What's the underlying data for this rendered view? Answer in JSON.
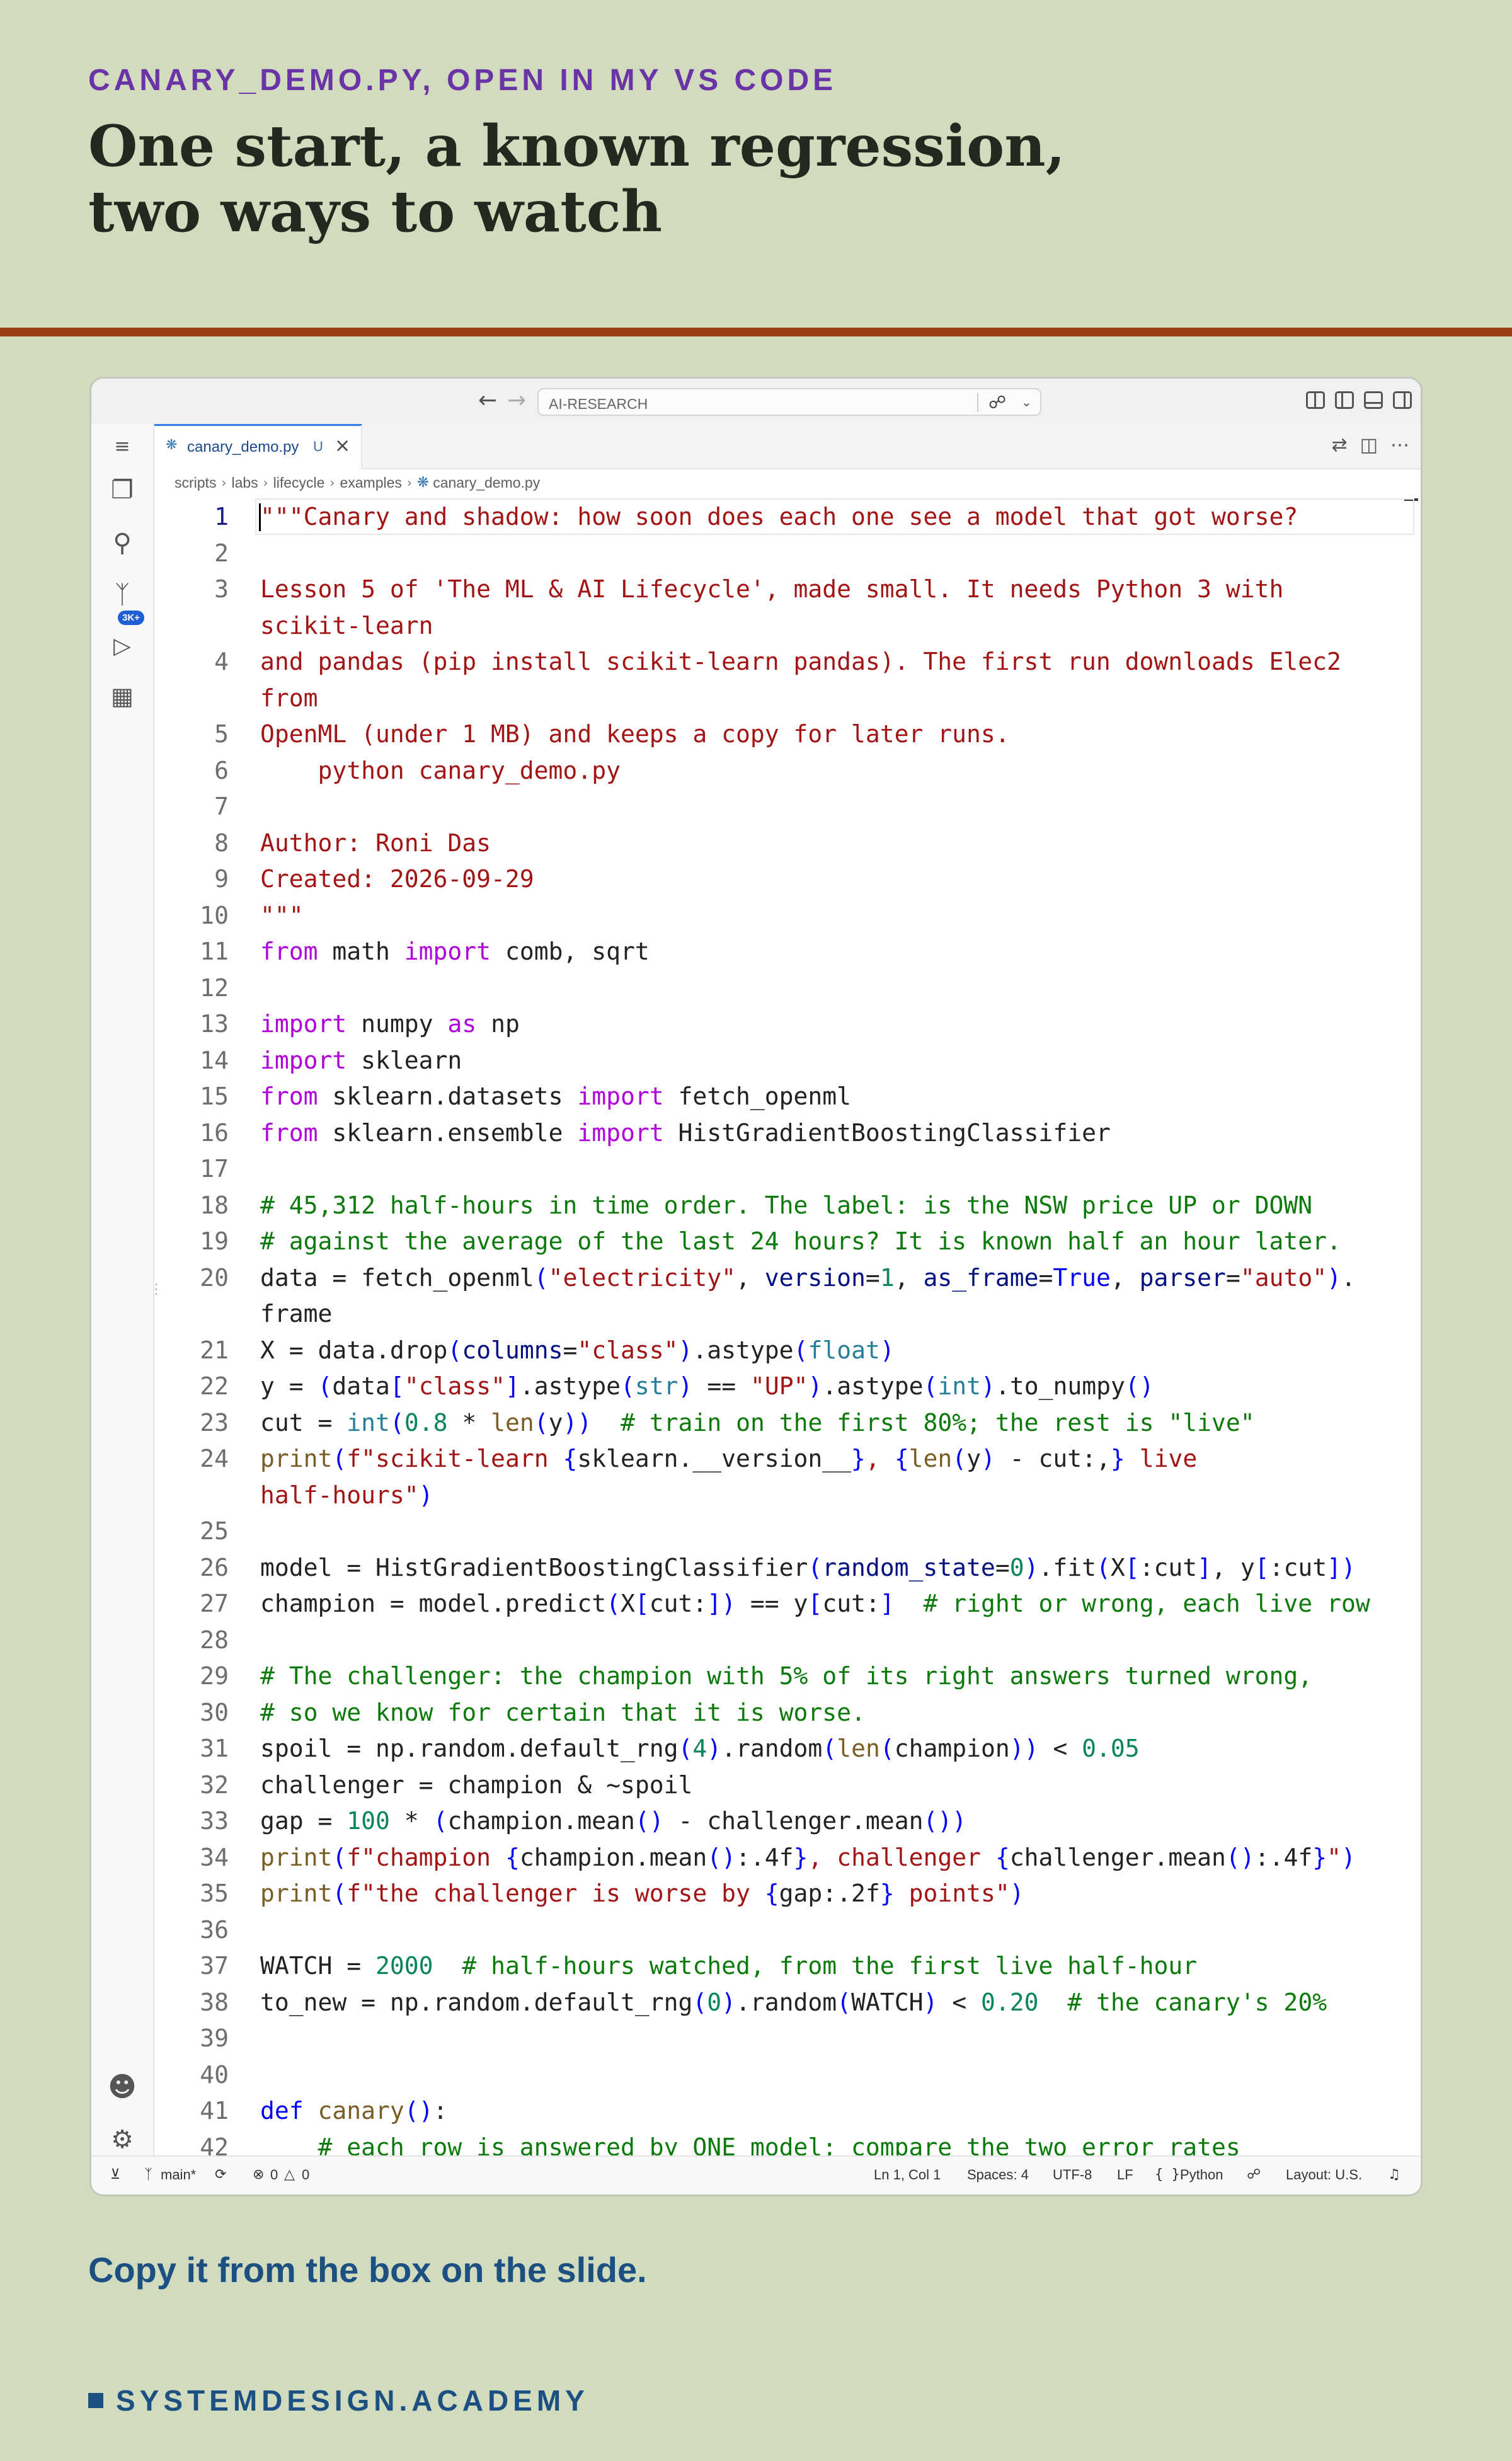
{
  "slide": {
    "kicker": "CANARY_DEMO.PY, OPEN IN MY VS CODE",
    "title_line1": "One start, a known regression,",
    "title_line2": "two ways to watch",
    "caption": "Copy it from the box on the slide.",
    "brand": "SYSTEMDESIGN.ACADEMY"
  },
  "window": {
    "search_label": "AI-RESEARCH",
    "back_icon": "arrow-left-icon",
    "forward_icon": "arrow-right-icon",
    "tab": {
      "filename": "canary_demo.py",
      "status": "U"
    },
    "breadcrumbs": [
      "scripts",
      "labs",
      "lifecycle",
      "examples",
      "canary_demo.py"
    ],
    "activity": {
      "source_control_badge": "3K+"
    }
  },
  "status": {
    "branch": "main*",
    "errors": "0",
    "warnings": "0",
    "position": "Ln 1, Col 1",
    "spaces": "Spaces: 4",
    "encoding": "UTF-8",
    "eol": "LF",
    "language": "Python",
    "layout": "Layout: U.S."
  },
  "editor": {
    "active_line": 1,
    "lines": [
      {
        "n": "1",
        "t": [
          [
            "str",
            "\"\"\"Canary and shadow: how soon does each one see a model that got worse?"
          ]
        ]
      },
      {
        "n": "2",
        "t": []
      },
      {
        "n": "3",
        "t": [
          [
            "str",
            "Lesson 5 of 'The ML & AI Lifecycle', made small. It needs Python 3 with"
          ]
        ]
      },
      {
        "n": "",
        "t": [
          [
            "str",
            "scikit-learn"
          ]
        ]
      },
      {
        "n": "4",
        "t": [
          [
            "str",
            "and pandas (pip install scikit-learn pandas). The first run downloads Elec2"
          ]
        ]
      },
      {
        "n": "",
        "t": [
          [
            "str",
            "from"
          ]
        ]
      },
      {
        "n": "5",
        "t": [
          [
            "str",
            "OpenML (under 1 MB) and keeps a copy for later runs."
          ]
        ]
      },
      {
        "n": "6",
        "t": [
          [
            "str",
            "    python canary_demo.py"
          ]
        ]
      },
      {
        "n": "7",
        "t": []
      },
      {
        "n": "8",
        "t": [
          [
            "str",
            "Author: Roni Das"
          ]
        ]
      },
      {
        "n": "9",
        "t": [
          [
            "str",
            "Created: 2026-09-29"
          ]
        ]
      },
      {
        "n": "10",
        "t": [
          [
            "str",
            "\"\"\""
          ]
        ]
      },
      {
        "n": "11",
        "t": [
          [
            "kw",
            "from"
          ],
          [
            "",
            "  math "
          ],
          [
            "kw",
            "import"
          ],
          [
            "",
            " comb, sqrt"
          ]
        ]
      },
      {
        "n": "12",
        "t": []
      },
      {
        "n": "13",
        "t": [
          [
            "kw",
            "import"
          ],
          [
            "",
            " numpy "
          ],
          [
            "kw",
            "as"
          ],
          [
            "",
            " np"
          ]
        ]
      },
      {
        "n": "14",
        "t": [
          [
            "kw",
            "import"
          ],
          [
            "",
            " sklearn"
          ]
        ]
      },
      {
        "n": "15",
        "t": [
          [
            "kw",
            "from"
          ],
          [
            "",
            " sklearn.datasets "
          ],
          [
            "kw",
            "import"
          ],
          [
            "",
            " fetch_openml"
          ]
        ]
      },
      {
        "n": "16",
        "t": [
          [
            "kw",
            "from"
          ],
          [
            "",
            " sklearn.ensemble "
          ],
          [
            "kw",
            "import"
          ],
          [
            "",
            " HistGradientBoostingClassifier"
          ]
        ]
      },
      {
        "n": "17",
        "t": []
      },
      {
        "n": "18",
        "t": [
          [
            "cm",
            "# 45,312 half-hours in time order. The label: is the NSW price UP or DOWN"
          ]
        ]
      },
      {
        "n": "19",
        "t": [
          [
            "cm",
            "# against the average of the last 24 hours? It is known half an hour later."
          ]
        ]
      },
      {
        "n": "20",
        "t": [
          [
            "",
            " data = fetch_openml"
          ],
          [
            "blue",
            "("
          ],
          [
            "str",
            "\"electricity\""
          ],
          [
            "",
            ", "
          ],
          [
            "var",
            "version"
          ],
          [
            "",
            "="
          ],
          [
            "num",
            "1"
          ],
          [
            "",
            ", "
          ],
          [
            "var",
            "as_frame"
          ],
          [
            "",
            "="
          ],
          [
            "blue",
            "True"
          ],
          [
            "",
            ", "
          ],
          [
            "var",
            "parser"
          ],
          [
            "",
            "="
          ],
          [
            "str",
            "\"auto\""
          ],
          [
            "blue",
            ")"
          ],
          [
            "",
            "."
          ]
        ]
      },
      {
        "n": "",
        "t": [
          [
            "",
            "frame"
          ]
        ]
      },
      {
        "n": "21",
        "t": [
          [
            "",
            "X = data.drop"
          ],
          [
            "blue",
            "("
          ],
          [
            "var",
            "columns"
          ],
          [
            "",
            "="
          ],
          [
            "str",
            "\"class\""
          ],
          [
            "blue",
            ")"
          ],
          [
            "",
            ".astype"
          ],
          [
            "blue",
            "("
          ],
          [
            "cls",
            "float"
          ],
          [
            "blue",
            ")"
          ]
        ]
      },
      {
        "n": "22",
        "t": [
          [
            "",
            "y = "
          ],
          [
            "blue",
            "("
          ],
          [
            "",
            "data"
          ],
          [
            "blue",
            "["
          ],
          [
            "str",
            "\"class\""
          ],
          [
            "blue",
            "]"
          ],
          [
            "",
            ".astype"
          ],
          [
            "blue",
            "("
          ],
          [
            "cls",
            "str"
          ],
          [
            "blue",
            ")"
          ],
          [
            "",
            " == "
          ],
          [
            "str",
            "\"UP\""
          ],
          [
            "blue",
            ")"
          ],
          [
            "",
            ".astype"
          ],
          [
            "blue",
            "("
          ],
          [
            "cls",
            "int"
          ],
          [
            "blue",
            ")"
          ],
          [
            "",
            ".to_numpy"
          ],
          [
            "blue",
            "()"
          ]
        ]
      },
      {
        "n": "23",
        "t": [
          [
            "",
            "cut = "
          ],
          [
            "cls",
            "int"
          ],
          [
            "blue",
            "("
          ],
          [
            "num",
            "0.8"
          ],
          [
            "",
            " * "
          ],
          [
            "fn",
            "len"
          ],
          [
            "blue",
            "("
          ],
          [
            "",
            "y"
          ],
          [
            "blue",
            "))"
          ],
          [
            "",
            "  "
          ],
          [
            "cm",
            "# train on the first 80%; the rest is \"live\""
          ]
        ]
      },
      {
        "n": "24",
        "t": [
          [
            "fn",
            "print"
          ],
          [
            "blue",
            "("
          ],
          [
            "str",
            "f\"scikit-learn "
          ],
          [
            "blue",
            "{"
          ],
          [
            "",
            "sklearn.__version__"
          ],
          [
            "blue",
            "}"
          ],
          [
            "str",
            ", "
          ],
          [
            "blue",
            "{"
          ],
          [
            "fn",
            "len"
          ],
          [
            "blue",
            "("
          ],
          [
            "",
            "y"
          ],
          [
            "blue",
            ")"
          ],
          [
            "",
            " - cut:,"
          ],
          [
            "blue",
            "}"
          ],
          [
            "str",
            " live"
          ]
        ]
      },
      {
        "n": "",
        "t": [
          [
            "str",
            "half-hours\""
          ],
          [
            "blue",
            ")"
          ]
        ]
      },
      {
        "n": "25",
        "t": []
      },
      {
        "n": "26",
        "t": [
          [
            "",
            "model = HistGradientBoostingClassifier"
          ],
          [
            "blue",
            "("
          ],
          [
            "var",
            "random_state"
          ],
          [
            "",
            "="
          ],
          [
            "num",
            "0"
          ],
          [
            "blue",
            ")"
          ],
          [
            "",
            ".fit"
          ],
          [
            "blue",
            "("
          ],
          [
            "",
            "X"
          ],
          [
            "blue",
            "["
          ],
          [
            "",
            ":cut"
          ],
          [
            "blue",
            "]"
          ],
          [
            "",
            ", y"
          ],
          [
            "blue",
            "["
          ],
          [
            "",
            ":cut"
          ],
          [
            "blue",
            "])"
          ]
        ]
      },
      {
        "n": "27",
        "t": [
          [
            "",
            "champion = model.predict"
          ],
          [
            "blue",
            "("
          ],
          [
            "",
            "X"
          ],
          [
            "blue",
            "["
          ],
          [
            "",
            "cut:"
          ],
          [
            "blue",
            "])"
          ],
          [
            "",
            " == y"
          ],
          [
            "blue",
            "["
          ],
          [
            "",
            "cut:"
          ],
          [
            "blue",
            "]"
          ],
          [
            "",
            "  "
          ],
          [
            "cm",
            "# right or wrong, each live row"
          ]
        ]
      },
      {
        "n": "28",
        "t": []
      },
      {
        "n": "29",
        "t": [
          [
            "cm",
            "# The challenger: the champion with 5% of its right answers turned wrong,"
          ]
        ]
      },
      {
        "n": "30",
        "t": [
          [
            "cm",
            "# so we know for certain that it is worse."
          ]
        ]
      },
      {
        "n": "31",
        "t": [
          [
            "",
            "spoil = np.random.default_rng"
          ],
          [
            "blue",
            "("
          ],
          [
            "num",
            "4"
          ],
          [
            "blue",
            ")"
          ],
          [
            "",
            ".random"
          ],
          [
            "blue",
            "("
          ],
          [
            "fn",
            "len"
          ],
          [
            "blue",
            "("
          ],
          [
            "",
            "champion"
          ],
          [
            "blue",
            "))"
          ],
          [
            "",
            " < "
          ],
          [
            "num",
            "0.05"
          ]
        ]
      },
      {
        "n": "32",
        "t": [
          [
            "",
            "challenger = champion & ~spoil"
          ]
        ]
      },
      {
        "n": "33",
        "t": [
          [
            "",
            "gap = "
          ],
          [
            "num",
            "100"
          ],
          [
            "",
            " * "
          ],
          [
            "blue",
            "("
          ],
          [
            "",
            "champion.mean"
          ],
          [
            "blue",
            "()"
          ],
          [
            "",
            " - challenger.mean"
          ],
          [
            "blue",
            "())"
          ]
        ]
      },
      {
        "n": "34",
        "t": [
          [
            "fn",
            "print"
          ],
          [
            "blue",
            "("
          ],
          [
            "str",
            "f\"champion "
          ],
          [
            "blue",
            "{"
          ],
          [
            "",
            "champion.mean"
          ],
          [
            "blue",
            "()"
          ],
          [
            "",
            ":.4f"
          ],
          [
            "blue",
            "}"
          ],
          [
            "str",
            ", challenger "
          ],
          [
            "blue",
            "{"
          ],
          [
            "",
            "challenger.mean"
          ],
          [
            "blue",
            "()"
          ],
          [
            "",
            ":.4f"
          ],
          [
            "blue",
            "}"
          ],
          [
            "str",
            "\""
          ],
          [
            "blue",
            ")"
          ]
        ]
      },
      {
        "n": "35",
        "t": [
          [
            "fn",
            "print"
          ],
          [
            "blue",
            "("
          ],
          [
            "str",
            "f\"the challenger is worse by "
          ],
          [
            "blue",
            "{"
          ],
          [
            "",
            "gap:.2f"
          ],
          [
            "blue",
            "}"
          ],
          [
            "str",
            " points\""
          ],
          [
            "blue",
            ")"
          ]
        ]
      },
      {
        "n": "36",
        "t": []
      },
      {
        "n": "37",
        "t": [
          [
            "",
            "WATCH = "
          ],
          [
            "num",
            "2000"
          ],
          [
            "",
            "  "
          ],
          [
            "cm",
            "# half-hours watched, from the first live half-hour"
          ]
        ]
      },
      {
        "n": "38",
        "t": [
          [
            "",
            "to_new = np.random.default_rng"
          ],
          [
            "blue",
            "("
          ],
          [
            "num",
            "0"
          ],
          [
            "blue",
            ")"
          ],
          [
            "",
            ".random"
          ],
          [
            "blue",
            "("
          ],
          [
            "",
            "WATCH"
          ],
          [
            "blue",
            ")"
          ],
          [
            "",
            " < "
          ],
          [
            "num",
            "0.20"
          ],
          [
            "",
            "  "
          ],
          [
            "cm",
            "# the canary's 20%"
          ]
        ]
      },
      {
        "n": "39",
        "t": []
      },
      {
        "n": "40",
        "t": []
      },
      {
        "n": "41",
        "t": [
          [
            "blue",
            "def"
          ],
          [
            "",
            " "
          ],
          [
            "fn",
            "canary"
          ],
          [
            "blue",
            "()"
          ],
          [
            "",
            ":"
          ]
        ]
      },
      {
        "n": "42",
        "t": [
          [
            "",
            "    "
          ],
          [
            "cm",
            "# each row is answered by ONE model; compare the two error rates"
          ]
        ]
      }
    ]
  }
}
